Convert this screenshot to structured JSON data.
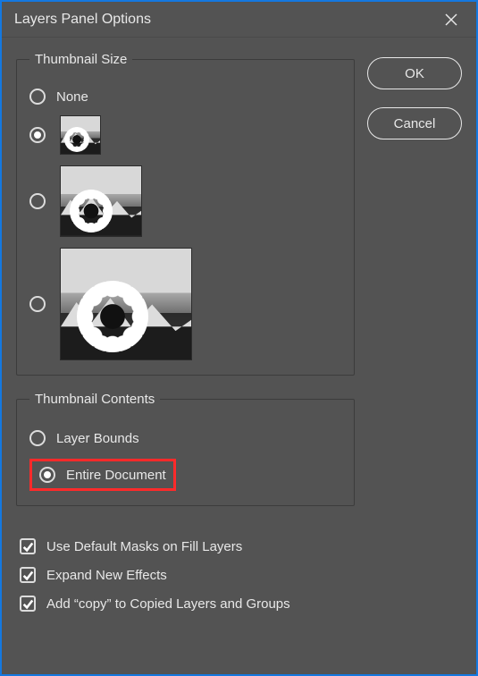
{
  "title": "Layers Panel Options",
  "buttons": {
    "ok": "OK",
    "cancel": "Cancel"
  },
  "thumbnail_size": {
    "legend": "Thumbnail Size",
    "none_label": "None",
    "selected_index": 1
  },
  "thumbnail_contents": {
    "legend": "Thumbnail Contents",
    "options": {
      "layer_bounds": "Layer Bounds",
      "entire_document": "Entire Document"
    },
    "selected": "entire_document"
  },
  "checkboxes": {
    "default_masks": {
      "label": "Use Default Masks on Fill Layers",
      "checked": true
    },
    "expand_effects": {
      "label": "Expand New Effects",
      "checked": true
    },
    "add_copy": {
      "label": "Add “copy” to Copied Layers and Groups",
      "checked": true
    }
  }
}
